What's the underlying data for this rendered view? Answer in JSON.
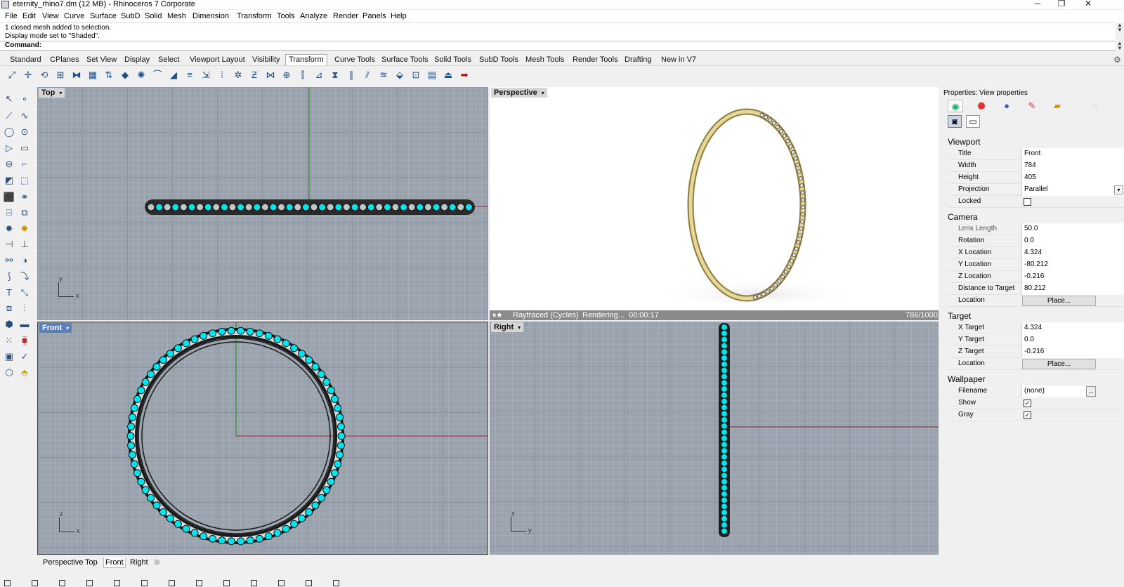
{
  "window": {
    "title": "eternity_rhino7.dm (12 MB) - Rhinoceros 7 Corporate",
    "minimize": "─",
    "maximize": "❐",
    "close": "✕"
  },
  "menu": [
    "File",
    "Edit",
    "View",
    "Curve",
    "Surface",
    "SubD",
    "Solid",
    "Mesh",
    "Dimension",
    "Transform",
    "Tools",
    "Analyze",
    "Render",
    "Panels",
    "Help"
  ],
  "history": [
    "1 closed mesh added to selection.",
    "Display mode set to \"Shaded\"."
  ],
  "command": {
    "label": "Command:",
    "value": ""
  },
  "toolbar_tabs": [
    "Standard",
    "CPlanes",
    "Set View",
    "Display",
    "Select",
    "Viewport Layout",
    "Visibility",
    "Transform",
    "Curve Tools",
    "Surface Tools",
    "Solid Tools",
    "SubD Tools",
    "Mesh Tools",
    "Render Tools",
    "Drafting",
    "New in V7"
  ],
  "active_tab": "Transform",
  "viewports": {
    "top": {
      "label": "Top",
      "dd": "▾",
      "axis_y": "y",
      "axis_x": "x"
    },
    "perspective": {
      "label": "Perspective",
      "dd": "▾",
      "render_mode": "Raytraced (Cycles)",
      "render_state": "Rendering...",
      "time": "00:00:17",
      "passes": "786/1000"
    },
    "front": {
      "label": "Front",
      "dd": "▾",
      "axis_y": "z",
      "axis_x": "x"
    },
    "right": {
      "label": "Right",
      "dd": "▾",
      "axis_y": "z",
      "axis_x": "y"
    }
  },
  "properties": {
    "panel_title": "Properties: View properties",
    "sections": {
      "viewport": "Viewport",
      "camera": "Camera",
      "target": "Target",
      "wallpaper": "Wallpaper"
    },
    "viewport": {
      "title_label": "Title",
      "title": "Front",
      "width_label": "Width",
      "width": "784",
      "height_label": "Height",
      "height": "405",
      "projection_label": "Projection",
      "projection": "Parallel",
      "locked_label": "Locked",
      "locked": ""
    },
    "camera": {
      "lens_label": "Lens Length",
      "lens": "50.0",
      "rotation_label": "Rotation",
      "rotation": "0.0",
      "xloc_label": "X Location",
      "xloc": "4.324",
      "yloc_label": "Y Location",
      "yloc": "-80.212",
      "zloc_label": "Z Location",
      "zloc": "-0.216",
      "dist_label": "Distance to Target",
      "dist": "80.212",
      "loc_label": "Location",
      "loc_btn": "Place..."
    },
    "target": {
      "x_label": "X Target",
      "x": "4.324",
      "y_label": "Y Target",
      "y": "0.0",
      "z_label": "Z Target",
      "z": "-0.216",
      "loc_label": "Location",
      "loc_btn": "Place..."
    },
    "wallpaper": {
      "filename_label": "Filename",
      "filename": "(none)",
      "browse": "...",
      "show_label": "Show",
      "show": "✓",
      "gray_label": "Gray",
      "gray": "✓"
    }
  },
  "viewport_tabs": [
    "Perspective",
    "Top",
    "Front",
    "Right"
  ],
  "active_viewport_tab": "Front",
  "add_tab": "⊕",
  "colors": {
    "gem": "#00e5ee",
    "gold": "#d9c47a",
    "grid": "#9aa3ad",
    "active_label": "#5b7fb8"
  }
}
